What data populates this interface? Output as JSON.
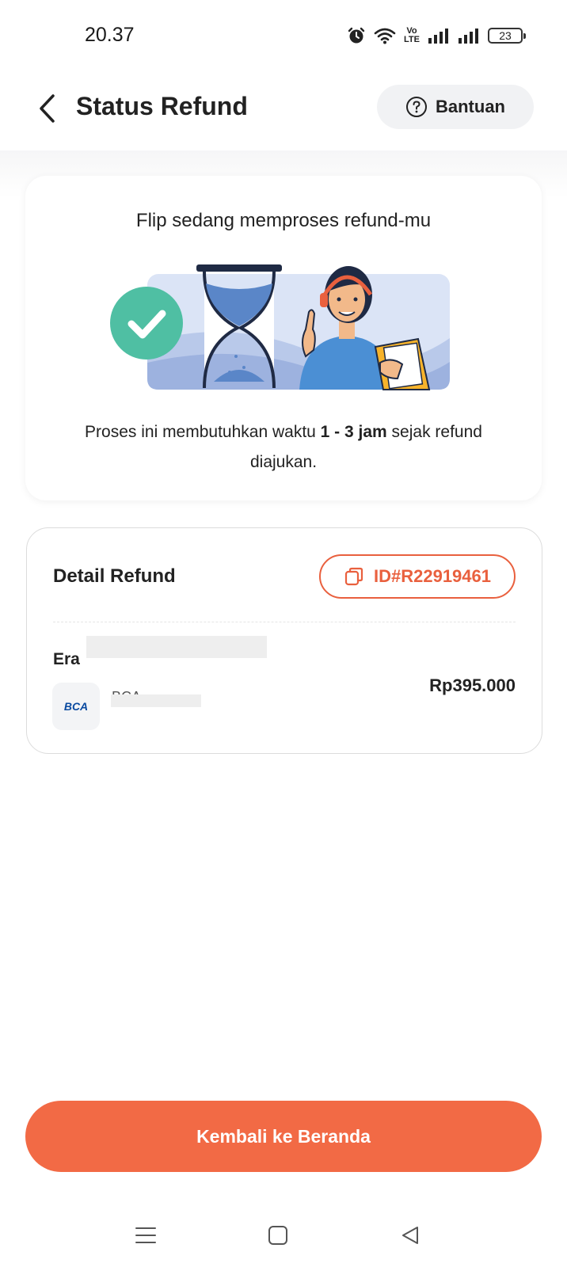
{
  "status_bar": {
    "time": "20.37",
    "volte_line1": "Vo",
    "volte_line2": "LTE",
    "battery": "23"
  },
  "header": {
    "title": "Status Refund",
    "help_label": "Bantuan"
  },
  "status_card": {
    "headline": "Flip sedang memproses refund-mu",
    "description_pre": "Proses ini membutuhkan waktu ",
    "description_bold": "1 - 3 jam",
    "description_post": " sejak refund diajukan."
  },
  "detail": {
    "title": "Detail Refund",
    "refund_id": "ID#R22919461",
    "recipient_name": "Era",
    "bank_logo_text": "BCA",
    "bank_name": "BCA",
    "amount": "Rp395.000"
  },
  "primary_button": {
    "label": "Kembali ke Beranda"
  },
  "colors": {
    "brand": "#f26a45",
    "id_accent": "#e9603e",
    "success": "#4fbfa3"
  },
  "icons": {
    "back": "chevron-left-icon",
    "help": "question-circle-icon",
    "copy": "copy-icon",
    "nav_menu": "menu-icon",
    "nav_home": "square-icon",
    "nav_back": "triangle-back-icon"
  }
}
